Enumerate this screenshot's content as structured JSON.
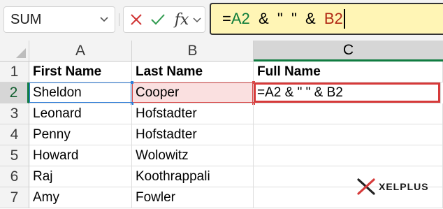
{
  "formula_bar": {
    "name_box": "SUM",
    "formula_parts": [
      {
        "text": "=",
        "role": "op"
      },
      {
        "text": "A2",
        "role": "ref-a"
      },
      {
        "text": "  &  \"  \"  &  ",
        "role": "op"
      },
      {
        "text": "B2",
        "role": "ref-b"
      }
    ],
    "fx_label": "fx"
  },
  "grid": {
    "columns": [
      "A",
      "B",
      "C"
    ],
    "rows": [
      "1",
      "2",
      "3",
      "4",
      "5",
      "6",
      "7"
    ],
    "cells": [
      [
        "First Name",
        "Last Name",
        "Full Name"
      ],
      [
        "Sheldon",
        "Cooper",
        "=A2 & \" \" & B2"
      ],
      [
        "Leonard",
        "Hofstadter",
        ""
      ],
      [
        "Penny",
        "Hofstadter",
        ""
      ],
      [
        "Howard",
        "Wolowitz",
        ""
      ],
      [
        "Raj",
        "Koothrappali",
        ""
      ],
      [
        "Amy",
        "Fowler",
        ""
      ]
    ],
    "active_cell": "C2"
  },
  "colors": {
    "ref_a": "#0e7c3a",
    "ref_b": "#b12a15",
    "formula_bg": "#fff5b5",
    "active_border": "#d63a3a",
    "header_selected_accent": "#107c41"
  },
  "logo": {
    "text": "XELPLUS"
  }
}
